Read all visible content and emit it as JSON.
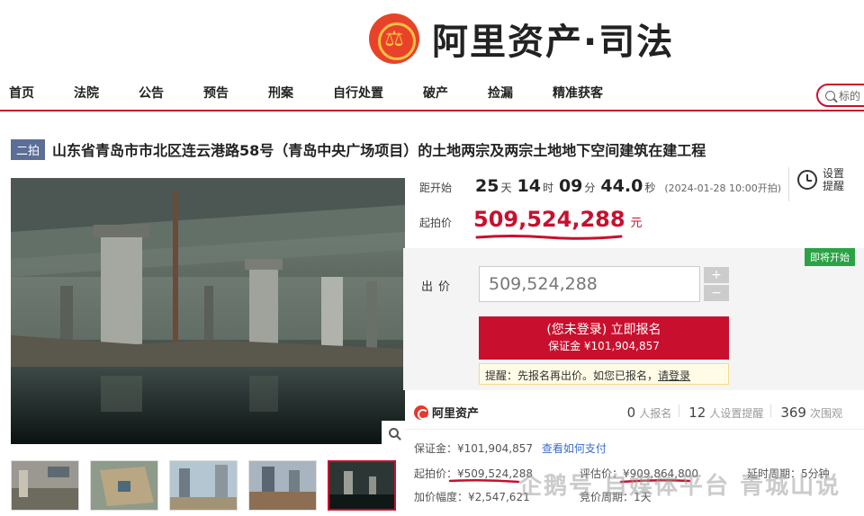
{
  "brand": {
    "name": "阿里资产·司法"
  },
  "nav": {
    "items": [
      "首页",
      "法院",
      "公告",
      "预告",
      "刑案",
      "自行处置",
      "破产",
      "捡漏",
      "精准获客"
    ],
    "search_placeholder": "标的"
  },
  "lot": {
    "round": "二拍",
    "title": "山东省青岛市市北区连云港路58号（青岛中央广场项目）的土地两宗及两宗土地地下空间建筑在建工程"
  },
  "countdown": {
    "label": "距开始",
    "days": "25",
    "days_unit": "天",
    "hours": "14",
    "hours_unit": "时",
    "minutes": "09",
    "minutes_unit": "分",
    "seconds": "44.0",
    "seconds_unit": "秒",
    "start_time": "(2024-01-28 10:00开拍)"
  },
  "reminder": {
    "label": "设置提醒"
  },
  "start_price": {
    "label": "起拍价",
    "value": "509,524,288",
    "unit": "元"
  },
  "bid": {
    "status_tag": "即将开始",
    "label": "出价",
    "input_value": "509,524,288",
    "plus": "+",
    "minus": "−",
    "cta_line1": "(您未登录) 立即报名",
    "cta_line2": "保证金 ¥101,904,857",
    "tip_text": "提醒：先报名再出价。如您已报名，",
    "tip_link": "请登录"
  },
  "platform": {
    "name": "阿里资产",
    "stats": [
      {
        "num": "0",
        "label": "人报名"
      },
      {
        "num": "12",
        "label": "人设置提醒"
      },
      {
        "num": "369",
        "label": "次围观"
      }
    ]
  },
  "details": {
    "deposit": "保证金：¥101,904,857",
    "deposit_link": "查看如何支付",
    "start_price": "起拍价：¥509,524,288",
    "appraisal": "评估价：¥909,864,800",
    "delay": "延时周期：5分钟",
    "increment": "加价幅度：¥2,547,621",
    "period": "竞价周期：1天"
  },
  "watermark": "企鹅号 自媒体平台 青城山说",
  "colors": {
    "accent": "#c8102e",
    "status_green": "#2ba245",
    "link": "#3a6dc7"
  },
  "icons": [
    "court-emblem-icon",
    "search-icon",
    "clock-icon",
    "zoom-icon",
    "alibaba-logo-icon"
  ]
}
